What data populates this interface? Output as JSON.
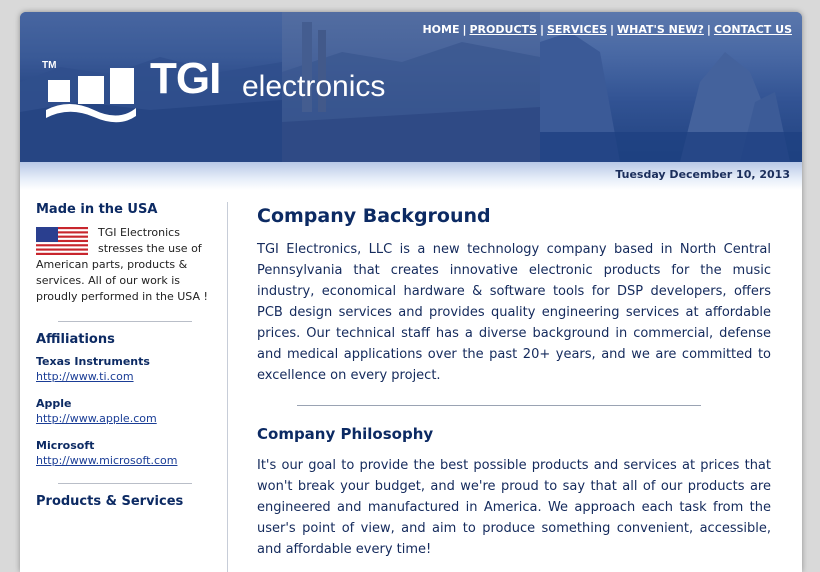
{
  "header": {
    "logo_tm": "TM",
    "logo_tgi": "TGI",
    "logo_electronics": "electronics",
    "nav": [
      {
        "label": "HOME"
      },
      {
        "label": "PRODUCTS"
      },
      {
        "label": "SERVICES"
      },
      {
        "label": "WHAT'S NEW?"
      },
      {
        "label": "CONTACT US"
      }
    ],
    "nav_separator": "|",
    "date": "Tuesday December 10, 2013"
  },
  "sidebar": {
    "made_in_usa": {
      "heading": "Made in the USA",
      "text": "TGI Electronics stresses the use of American parts, products & services.  All of our work is proudly performed in the USA !"
    },
    "affiliations": {
      "heading": "Affiliations",
      "items": [
        {
          "name": "Texas Instruments",
          "url": "http://www.ti.com"
        },
        {
          "name": "Apple",
          "url": "http://www.apple.com"
        },
        {
          "name": "Microsoft",
          "url": "http://www.microsoft.com"
        }
      ]
    },
    "next_heading": "Products & Services"
  },
  "main": {
    "background_title": "Company Background",
    "background_text": "TGI Electronics, LLC is a new technology company based in North Central Pennsylvania that creates innovative electronic products for the music industry, economical hardware & software tools for DSP developers, offers PCB design services and provides quality engineering services at affordable prices. Our technical staff has a diverse background in commercial, defense and medical applications over the past 20+ years, and we are committed to excellence on every project.",
    "philosophy_title": "Company Philosophy",
    "philosophy_text": "It's our goal to provide the best possible products and services at prices that won't break your budget, and we're proud to say that all of our products are engineered and manufactured in America. We approach each task from the user's point of view, and aim to produce something convenient, accessible, and affordable every time!"
  },
  "colors": {
    "accent": "#0c2a63",
    "link": "#1a3d96",
    "banner": "#2b4b85"
  }
}
